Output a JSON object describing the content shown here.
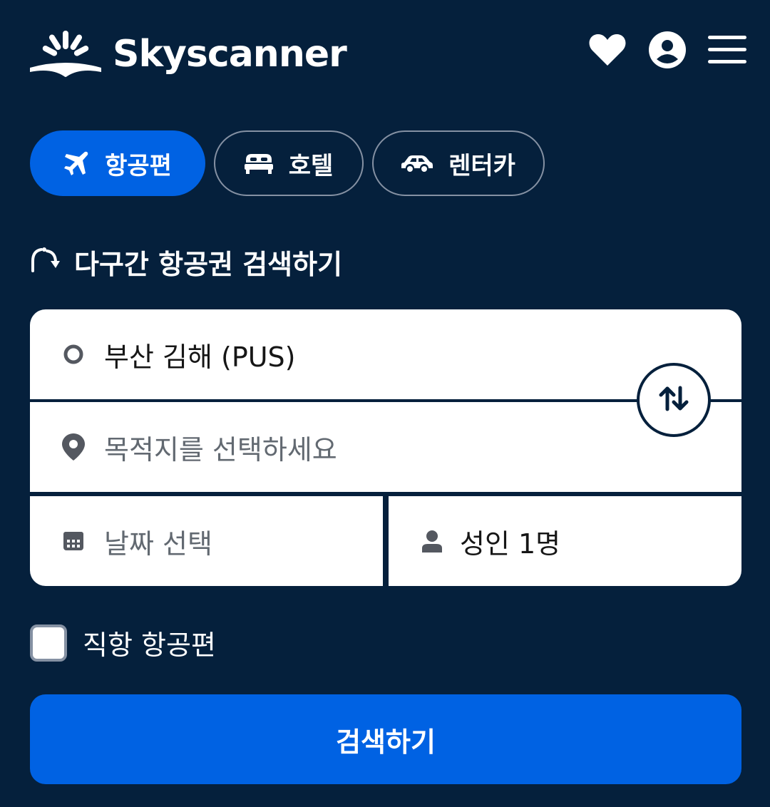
{
  "header": {
    "brand": "Skyscanner",
    "icons": [
      "heart-icon",
      "account-icon",
      "menu-icon"
    ]
  },
  "tabs": [
    {
      "label": "항공편",
      "icon": "plane-icon",
      "active": true
    },
    {
      "label": "호텔",
      "icon": "bed-icon",
      "active": false
    },
    {
      "label": "렌터카",
      "icon": "car-icon",
      "active": false
    }
  ],
  "multi_city": {
    "label": "다구간 항공권 검색하기",
    "icon": "multi-city-icon"
  },
  "form": {
    "origin": {
      "value": "부산 김해 (PUS)",
      "icon": "origin-circle-icon"
    },
    "destination": {
      "placeholder": "목적지를 선택하세요",
      "icon": "location-pin-icon"
    },
    "date": {
      "placeholder": "날짜 선택",
      "icon": "calendar-icon"
    },
    "travellers": {
      "value": "성인 1명",
      "icon": "person-icon"
    },
    "swap": {
      "icon": "swap-arrows-icon"
    }
  },
  "direct_flights": {
    "label": "직항 항공편",
    "checked": false
  },
  "search": {
    "label": "검색하기"
  },
  "colors": {
    "background": "#05203c",
    "accent": "#0062e3",
    "card": "#ffffff",
    "muted_text": "#626971"
  }
}
